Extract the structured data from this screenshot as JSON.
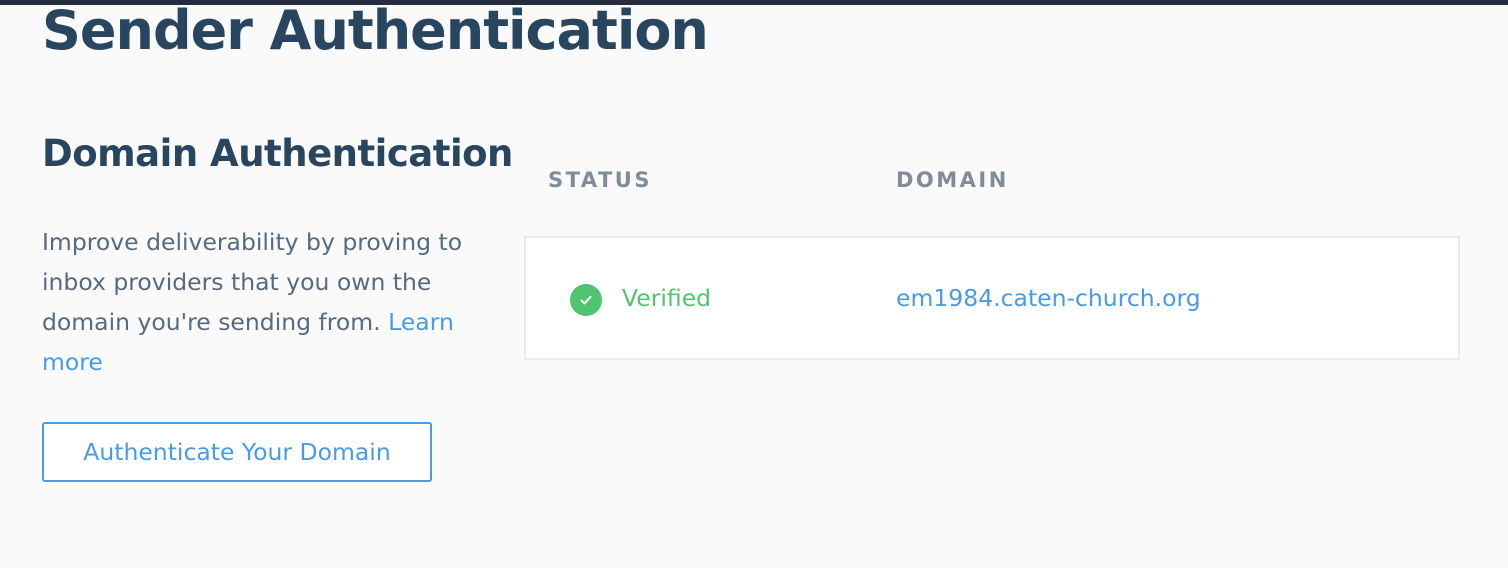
{
  "page": {
    "title": "Sender Authentication"
  },
  "domain_authentication": {
    "title": "Domain Authentication",
    "description": "Improve deliverability by proving to inbox providers that you own the domain you're sending from.",
    "learn_more_label": "Learn more",
    "button_label": "Authenticate Your Domain"
  },
  "table": {
    "columns": [
      "STATUS",
      "DOMAIN"
    ],
    "rows": [
      {
        "status": "Verified",
        "status_icon": "check-circle-icon",
        "domain": "em1984.caten-church.org"
      }
    ]
  },
  "colors": {
    "heading": "#294661",
    "body_text": "#546b81",
    "link": "#489be8",
    "success": "#50c46f",
    "column_header": "#7f8d9b",
    "top_bar": "#262b3d"
  }
}
